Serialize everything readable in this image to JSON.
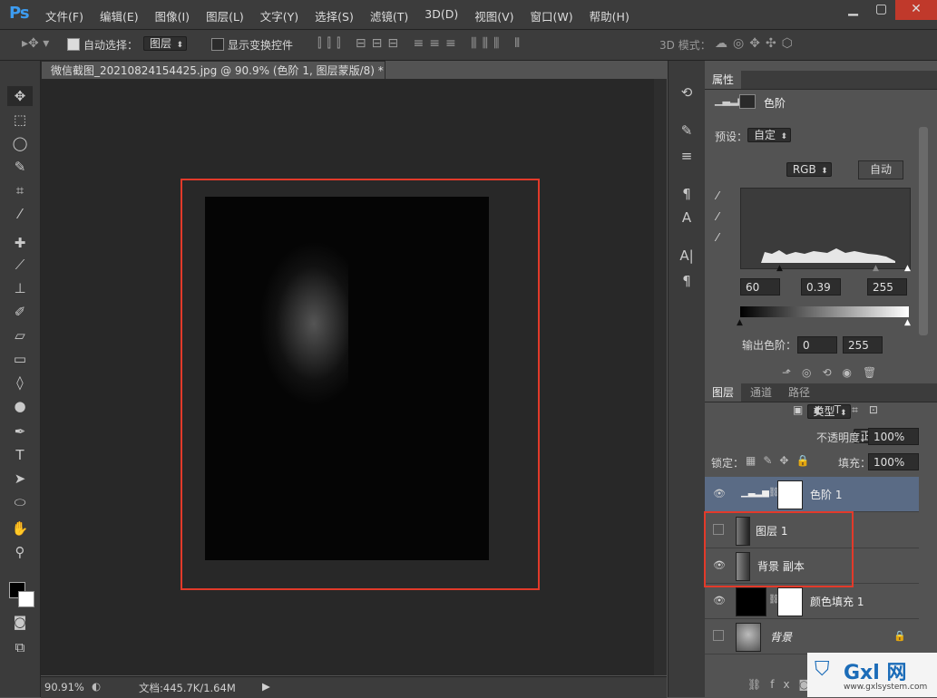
{
  "app": {
    "logo": "Ps"
  },
  "menu": [
    "文件(F)",
    "编辑(E)",
    "图像(I)",
    "图层(L)",
    "文字(Y)",
    "选择(S)",
    "滤镜(T)",
    "3D(D)",
    "视图(V)",
    "窗口(W)",
    "帮助(H)"
  ],
  "options": {
    "auto_select_label": "自动选择：",
    "auto_select_value": "图层",
    "show_transform": "显示变换控件",
    "mode3d": "3D 模式："
  },
  "document": {
    "tab_title": "微信截图_20210824154425.jpg @ 90.9% (色阶 1, 图层蒙版/8) *",
    "close": "×"
  },
  "status": {
    "zoom": "90.91%",
    "doc_info": "文档:445.7K/1.64M"
  },
  "properties": {
    "tab": "属性",
    "type_label": "色阶",
    "preset_label": "预设：",
    "preset_value": "自定",
    "channel_value": "RGB",
    "auto_button": "自动",
    "input_black": "60",
    "input_mid": "0.39",
    "input_white": "255",
    "output_label": "输出色阶：",
    "output_black": "0",
    "output_white": "255"
  },
  "layers_panel": {
    "tabs": [
      "图层",
      "通道",
      "路径"
    ],
    "filter_value": "类型",
    "blend_mode": "正常",
    "opacity_label": "不透明度：",
    "opacity_value": "100%",
    "lock_label": "锁定：",
    "fill_label": "填充：",
    "fill_value": "100%",
    "layers": [
      {
        "name": "色阶 1",
        "visible": true,
        "selected": true
      },
      {
        "name": "图层 1",
        "visible": false,
        "selected": false
      },
      {
        "name": "背景 副本",
        "visible": true,
        "selected": false
      },
      {
        "name": "颜色填充 1",
        "visible": true,
        "selected": false
      },
      {
        "name": "背景",
        "visible": false,
        "selected": false
      }
    ]
  },
  "watermark": {
    "brand": "Gxl 网",
    "url": "www.gxlsystem.com"
  },
  "colors": {
    "accent": "#3d9cf0",
    "highlight_box": "#e23a2a",
    "selected_layer": "#5a6b85"
  }
}
